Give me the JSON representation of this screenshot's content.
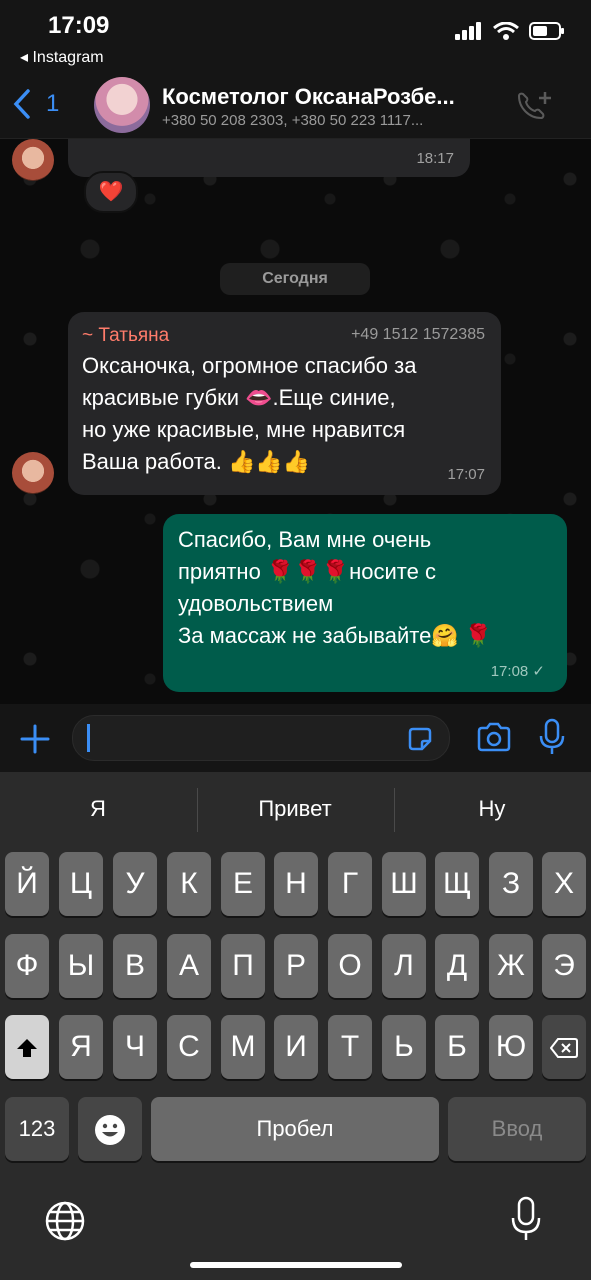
{
  "status_bar": {
    "time": "17:09",
    "back_app": "◂ Instagram"
  },
  "header": {
    "back_count": "1",
    "title": "Косметолог ОксанаРозбе...",
    "subtitle": "+380 50 208 2303, +380 50 223 1117..."
  },
  "chat": {
    "prev_time": "18:17",
    "reaction": "❤️",
    "day_label": "Сегодня",
    "incoming": {
      "sender": "~ Татьяна",
      "phone": "+49 1512 1572385",
      "lines": [
        "Оксаночка, огромное спасибо за",
        "красивые губки 👄.Еще синие,",
        "но уже красивые, мне нравится",
        "Ваша работа. 👍👍👍"
      ],
      "time": "17:07"
    },
    "outgoing": {
      "lines": [
        "Спасибо, Вам мне очень",
        "приятно 🌹🌹🌹носите с",
        "удовольствием",
        "За массаж не забывайте🤗 🌹"
      ],
      "time": "17:08 ✓"
    }
  },
  "keyboard": {
    "suggestions": [
      "Я",
      "Привет",
      "Ну"
    ],
    "row1": [
      "Й",
      "Ц",
      "У",
      "К",
      "Е",
      "Н",
      "Г",
      "Ш",
      "Щ",
      "З",
      "Х"
    ],
    "row2": [
      "Ф",
      "Ы",
      "В",
      "А",
      "П",
      "Р",
      "О",
      "Л",
      "Д",
      "Ж",
      "Э"
    ],
    "row3": [
      "Я",
      "Ч",
      "С",
      "М",
      "И",
      "Т",
      "Ь",
      "Б",
      "Ю"
    ],
    "numbers_label": "123",
    "space_label": "Пробел",
    "enter_label": "Ввод"
  }
}
